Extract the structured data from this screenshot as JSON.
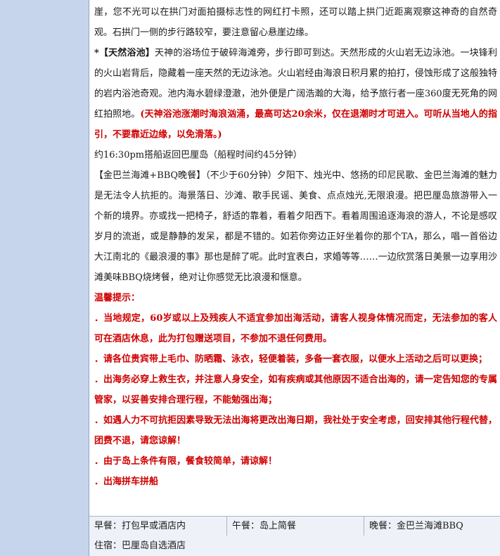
{
  "intro": {
    "p1": "崖，您不光可以在拱门对面拍摄标志性的网红打卡照，还可以踏上拱门近距离观察这神奇的自然奇观。石拱门一侧的步行路较窄，要注意留心悬崖边缘。"
  },
  "pool": {
    "bullet": "*",
    "title": "【天然浴池】",
    "body": "天神的浴场位于破碎海滩旁，步行即可到达。天然形成的火山岩无边泳池。一块锋利的火山岩背后，隐藏着一座天然的无边泳池。火山岩经由海浪日积月累的拍打，侵蚀形成了这般独特的岩内浴池奇观。池内海水碧绿澄澈，池外便是广阔浩瀚的大海，给予旅行者一座360度无死角的网红拍照地。",
    "warning": "(天神浴池涨潮时海浪汹涌，最高可达20余米，仅在退潮时才可进入。可听从当地人的指引，不要靠近边缘，以免滑落。)"
  },
  "return": {
    "text": "约16:30pm搭船返回巴厘岛（船程时间约45分钟）"
  },
  "beach": {
    "text": "【金巴兰海滩+BBQ晚餐】（不少于60分钟）夕阳下、烛光中、悠扬的印尼民歌、金巴兰海滩的魅力是无法令人抗拒的。海景落日、沙滩、歌手民谣、美食、点点烛光,无限浪漫。把巴厘岛旅游带入一个新的境界。亦或找一把椅子，舒适的靠着，看着夕阳西下。看着周围追逐海浪的游人，不论是感叹岁月的流逝，或是静静的发呆，都是不错的。如若你旁边正好坐着你的那个TA，那么，唱一首俗边大江南北的《最浪漫的事》那也是醉了呢。此时宜表白，求婚等等……一边欣赏落日美景一边享用沙滩美味BBQ烧烤餐，绝对让你感觉无比浪漫和惬意。"
  },
  "tips": {
    "title": "温馨提示：",
    "items": [
      "．当地规定，60岁或以上及残疾人不适宜参加出海活动，请客人视身体情况而定，无法参加的客人可在酒店休息，此为打包赠送项目，不参加不退任何费用。",
      "．请各位贵宾带上毛巾、防晒霜、泳衣，轻便着装，多备一套衣服，以便水上活动之后可以更换；",
      "．出海务必穿上救生衣，并注意人身安全，如有疾病或其他原因不适合出海的，请一定告知您的专属管家，以妥善安排合理行程，不能勉强出海；",
      "．如遇人力不可抗拒因素导致无法出海将更改出海日期，我社处于安全考虑，回安排其他行程代替，团费不退，请您谅解！",
      "．由于岛上条件有限，餐食较简单，请谅解！",
      "．出海拼车拼船"
    ]
  },
  "meals": {
    "breakfast": "早餐：打包早或酒店内",
    "lunch": "午餐：岛上简餐",
    "dinner": "晚餐：金巴兰海滩BBQ"
  },
  "stay": {
    "text": "住宿：巴厘岛自选酒店"
  }
}
